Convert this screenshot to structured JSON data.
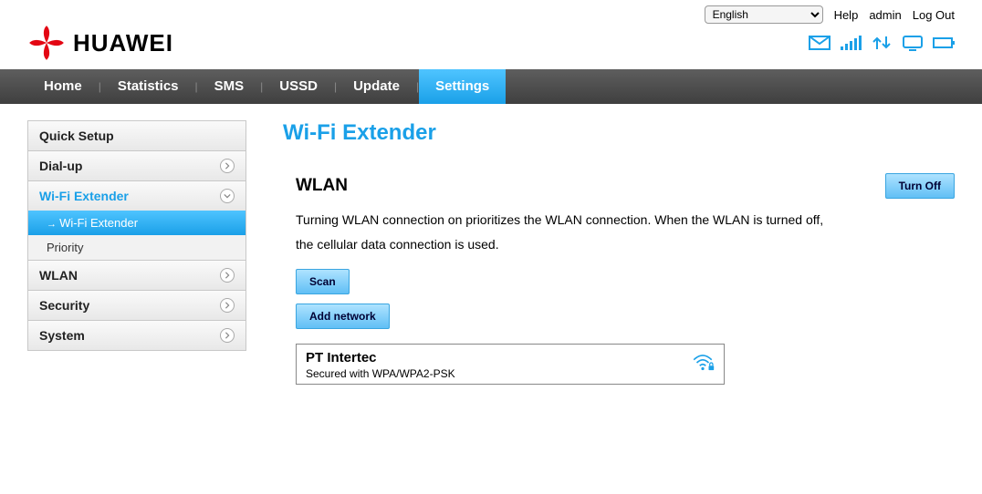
{
  "top": {
    "language": "English",
    "help": "Help",
    "user": "admin",
    "logout": "Log Out"
  },
  "brand": "HUAWEI",
  "nav": [
    "Home",
    "Statistics",
    "SMS",
    "USSD",
    "Update",
    "Settings"
  ],
  "nav_active_index": 5,
  "sidebar": {
    "quick_setup": "Quick Setup",
    "dialup": "Dial-up",
    "wifi_ext_group": "Wi-Fi Extender",
    "wifi_ext_sub": "Wi-Fi Extender",
    "priority_sub": "Priority",
    "wlan_group": "WLAN",
    "security_group": "Security",
    "system_group": "System"
  },
  "page": {
    "title": "Wi-Fi Extender",
    "section_title": "WLAN",
    "turn_off_btn": "Turn Off",
    "description": "Turning WLAN connection on prioritizes the WLAN connection. When the WLAN is turned off, the cellular data connection is used.",
    "scan_btn": "Scan",
    "add_network_btn": "Add network"
  },
  "network": {
    "name": "PT Intertec",
    "security": "Secured with WPA/WPA2-PSK"
  }
}
